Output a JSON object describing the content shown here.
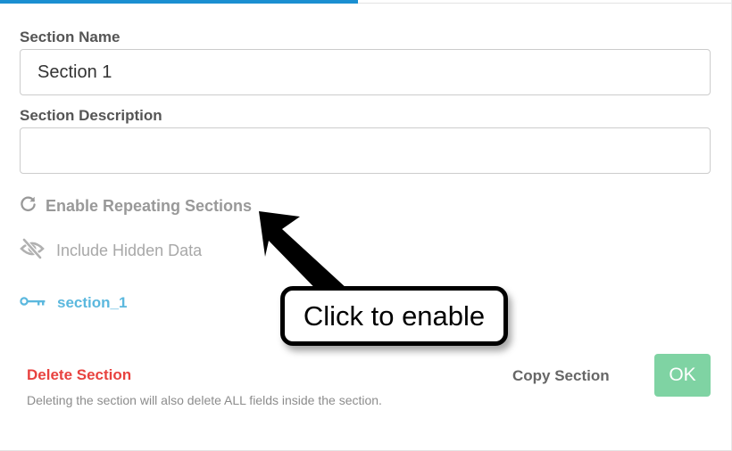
{
  "section_name": {
    "label": "Section Name",
    "value": "Section 1"
  },
  "section_description": {
    "label": "Section Description",
    "value": "",
    "placeholder": ""
  },
  "options": {
    "repeating": {
      "label": "Enable Repeating Sections",
      "icon": "refresh-icon"
    },
    "hidden_data": {
      "label": "Include Hidden Data",
      "icon": "eye-slash-icon"
    }
  },
  "key": {
    "icon": "key-icon",
    "label": "section_1"
  },
  "delete": {
    "label": "Delete Section",
    "note": "Deleting the section will also delete ALL fields inside the section."
  },
  "copy_label": "Copy Section",
  "ok_label": "OK",
  "callout": {
    "text": "Click to enable"
  },
  "colors": {
    "accent": "#1a8fd1",
    "danger": "#e8423f",
    "ok": "#7fd3a3",
    "key": "#5bb8de"
  }
}
